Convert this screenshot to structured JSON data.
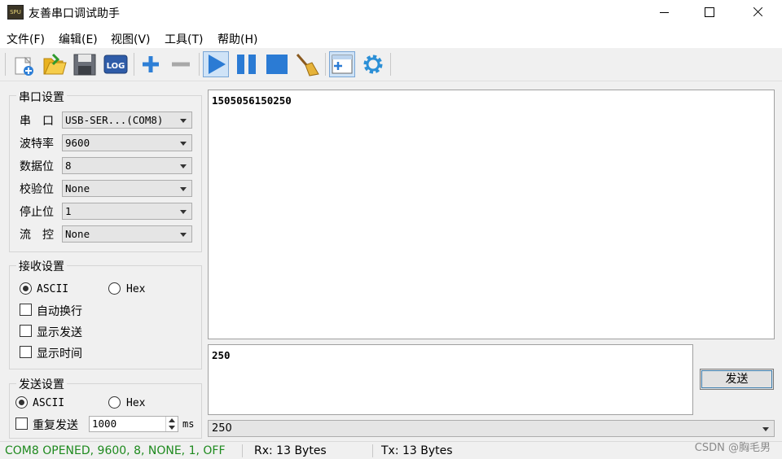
{
  "window": {
    "title": "友善串口调试助手",
    "icon_text": "SPU"
  },
  "menu": [
    "文件(F)",
    "编辑(E)",
    "视图(V)",
    "工具(T)",
    "帮助(H)"
  ],
  "toolbar": {
    "log_label": "LOG",
    "icons": [
      "new-file-icon",
      "open-folder-icon",
      "save-icon",
      "log-icon",
      "add-icon",
      "remove-icon",
      "play-icon",
      "pause-icon",
      "stop-icon",
      "clear-broom-icon",
      "add-window-icon",
      "settings-gear-icon"
    ]
  },
  "serial_settings": {
    "title": "串口设置",
    "fields": [
      {
        "label": "串　口",
        "value": "USB-SER...(COM8)"
      },
      {
        "label": "波特率",
        "value": "9600"
      },
      {
        "label": "数据位",
        "value": "8"
      },
      {
        "label": "校验位",
        "value": "None"
      },
      {
        "label": "停止位",
        "value": "1"
      },
      {
        "label": "流　控",
        "value": "None"
      }
    ]
  },
  "receive_settings": {
    "title": "接收设置",
    "ascii": "ASCII",
    "hex": "Hex",
    "mode": "ASCII",
    "auto_wrap": "自动换行",
    "show_send": "显示发送",
    "show_time": "显示时间"
  },
  "send_settings": {
    "title": "发送设置",
    "ascii": "ASCII",
    "hex": "Hex",
    "mode": "ASCII",
    "repeat": "重复发送",
    "interval": "1000",
    "unit": "ms"
  },
  "receive_text": "1505056150250",
  "send_text": "250",
  "send_button": "发送",
  "history_value": "250",
  "status": {
    "connection": "COM8 OPENED, 9600, 8, NONE, 1, OFF",
    "rx": "Rx: 13 Bytes",
    "tx": "Tx: 13 Bytes",
    "watermark": "CSDN @胸毛男"
  },
  "colors": {
    "status_green": "#1e8a1e",
    "play_blue": "#2b7bd4"
  }
}
